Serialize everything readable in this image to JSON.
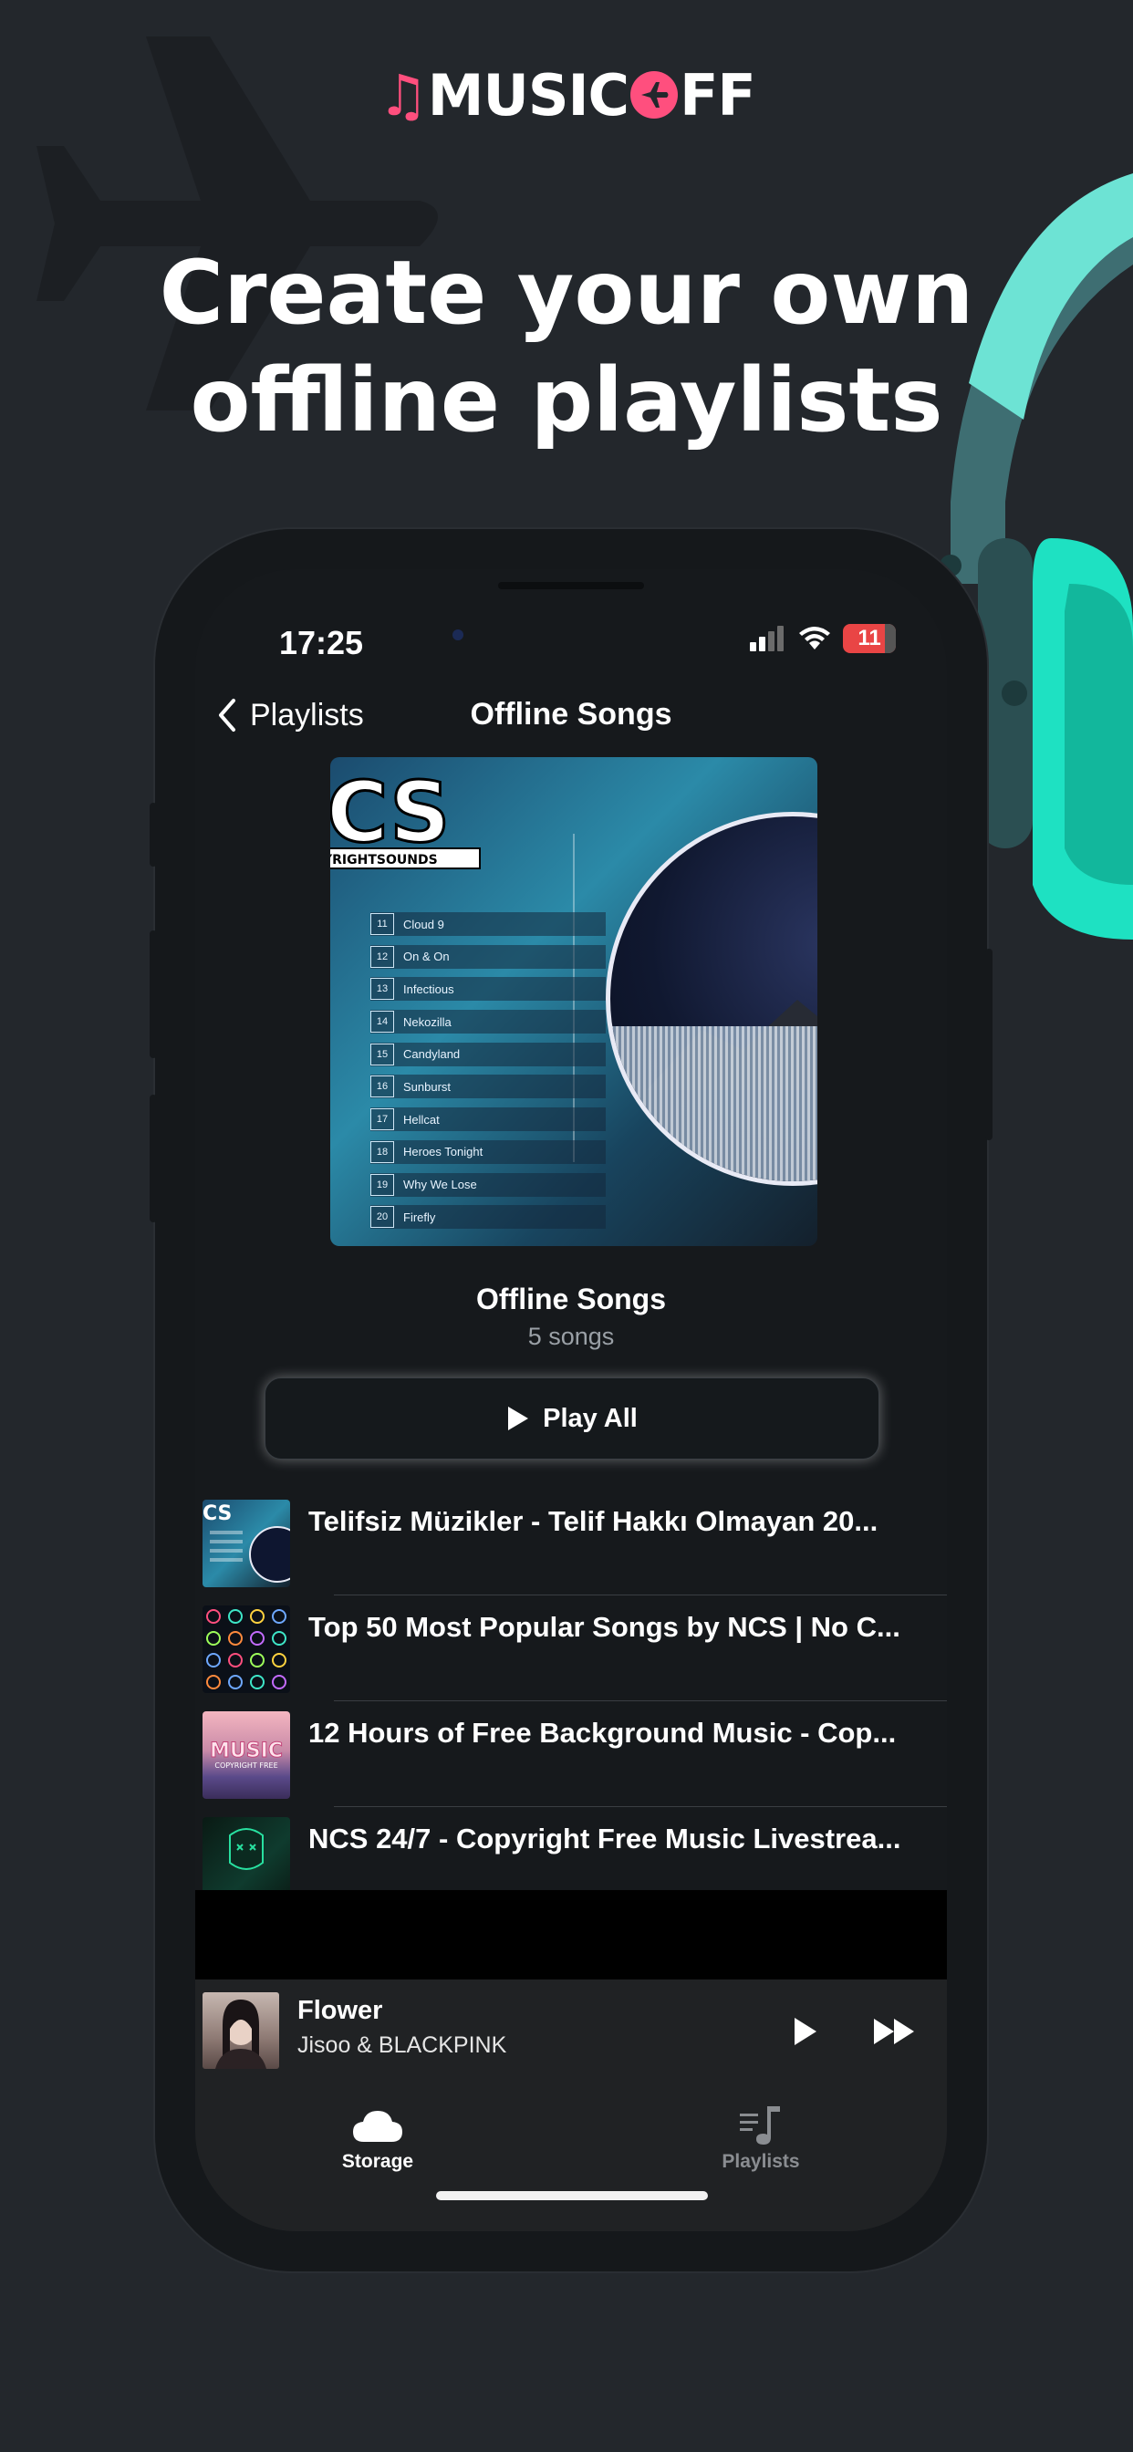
{
  "logo": {
    "text_before": "MUSIC",
    "text_after": "FF",
    "accent_color": "#ff4f7e"
  },
  "headline": {
    "line1": "Create your own",
    "line2": "offline playlists"
  },
  "status": {
    "time": "17:25",
    "battery": "11"
  },
  "nav": {
    "back_label": "Playlists",
    "title": "Offline Songs"
  },
  "cover": {
    "logo_text": "CS",
    "logo_sub": "YRIGHTSOUNDS",
    "tracks": [
      {
        "num": "11",
        "name": "Cloud 9"
      },
      {
        "num": "12",
        "name": "On & On"
      },
      {
        "num": "13",
        "name": "Infectious"
      },
      {
        "num": "14",
        "name": "Nekozilla"
      },
      {
        "num": "15",
        "name": "Candyland"
      },
      {
        "num": "16",
        "name": "Sunburst"
      },
      {
        "num": "17",
        "name": "Hellcat"
      },
      {
        "num": "18",
        "name": "Heroes Tonight"
      },
      {
        "num": "19",
        "name": "Why We Lose"
      },
      {
        "num": "20",
        "name": "Firefly"
      }
    ]
  },
  "playlist": {
    "title": "Offline Songs",
    "count": "5 songs",
    "play_all": "Play All"
  },
  "songs": [
    {
      "title": "Telifsiz Müzikler - Telif Hakkı Olmayan 20..."
    },
    {
      "title": "Top 50 Most Popular Songs by NCS | No C..."
    },
    {
      "title": "12 Hours of Free Background Music - Cop..."
    },
    {
      "title": "NCS 24/7 - Copyright Free Music Livestrea..."
    }
  ],
  "thumb_texts": {
    "music": "MUSIC",
    "music_sub": "COPYRIGHT FREE"
  },
  "mini_player": {
    "title": "Flower",
    "artist": "Jisoo & BLACKPINK"
  },
  "tabs": [
    {
      "label": "Storage",
      "icon": "cloud-icon",
      "active": true
    },
    {
      "label": "Playlists",
      "icon": "music-list-icon",
      "active": false
    }
  ]
}
